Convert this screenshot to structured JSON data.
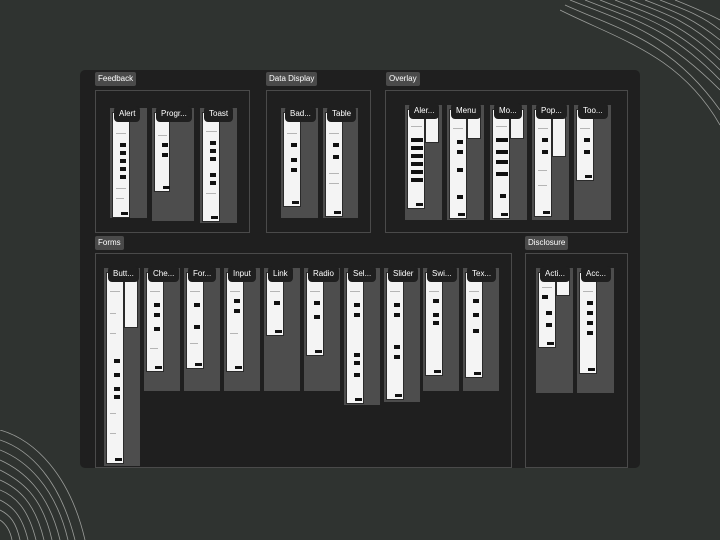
{
  "groups": {
    "feedback": {
      "label": "Feedback",
      "frames": [
        "Alert",
        "Progr...",
        "Toast"
      ]
    },
    "data_display": {
      "label": "Data Display",
      "frames": [
        "Bad...",
        "Table"
      ]
    },
    "overlay": {
      "label": "Overlay",
      "frames": [
        "Aler...",
        "Menu",
        "Mo...",
        "Pop...",
        "Too..."
      ]
    },
    "forms": {
      "label": "Forms",
      "frames": [
        "Butt...",
        "Che...",
        "For...",
        "Input",
        "Link",
        "Radio",
        "Sel...",
        "Slider",
        "Swi...",
        "Tex..."
      ]
    },
    "disclosure": {
      "label": "Disclosure",
      "frames": [
        "Acti...",
        "Acc..."
      ]
    }
  }
}
